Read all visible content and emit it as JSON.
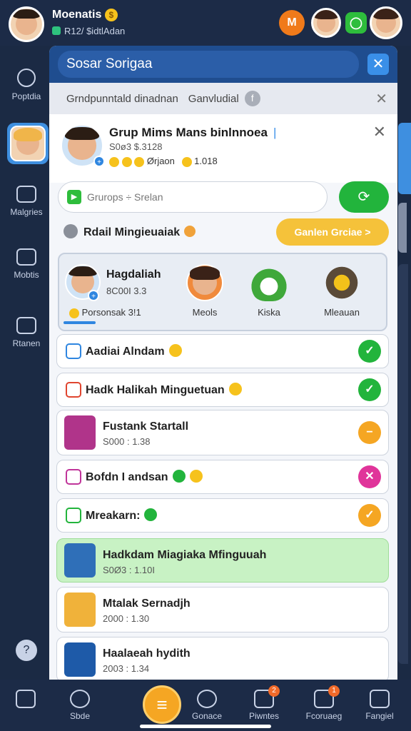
{
  "topbar": {
    "name": "Moenatis",
    "coin_glyph": "$",
    "subtitle": "R12/ $idtlAdan",
    "orange_button_label": "M"
  },
  "rail": {
    "items": [
      {
        "label": "Poptdia"
      },
      {
        "label": "Malgries"
      },
      {
        "label": "Mobtis"
      },
      {
        "label": "Rtanen"
      }
    ]
  },
  "panel": {
    "header_title": "Sosar Sorigaa",
    "subheader_left": "Grndpunntald dinadnan",
    "subheader_right": "Ganvludial",
    "subheader_info_glyph": "f",
    "close_glyph": "✕"
  },
  "group": {
    "title": "Grup Mims Mans binlnnoea",
    "code": "S0ø3 $.3128",
    "meta": "Ørjaon",
    "meta_num": "1.018"
  },
  "search": {
    "placeholder": "Grurops ÷ Srelan",
    "go_glyph": "⟳"
  },
  "recent": {
    "label": "Rdail Mingieuaiak",
    "action_label": "Ganlen Grciae >"
  },
  "feature": {
    "name": "Hagdaliah",
    "code": "8C00I 3.3",
    "tag": "Porsonsak 3!1",
    "progress_percent": 10,
    "thumbs": [
      {
        "label": "Meols"
      },
      {
        "label": "Kiska"
      },
      {
        "label": "Mleauan"
      }
    ]
  },
  "list": [
    {
      "label": "Aadiai Alndam",
      "action_color": "#22b43c",
      "action_glyph": "✓",
      "icon_color": "#2f86e0"
    },
    {
      "label": "Hadk Halikah Minguetuan",
      "action_color": "#22b43c",
      "action_glyph": "✓",
      "icon_color": "#e0452f"
    },
    {
      "title": "Fustank Startall",
      "sub": "S000 : 1.38",
      "action_color": "#f5a623",
      "action_glyph": "−"
    },
    {
      "label": "Bofdn I andsan",
      "action_color": "#e0349a",
      "action_glyph": "✕",
      "icon_color": "#c0349a"
    },
    {
      "label": "Mreakarn:",
      "action_color": "#f5a623",
      "action_glyph": "✓",
      "icon_color": "#22b43c"
    },
    {
      "title": "Hadkdam Miagiaka Mfinguuah",
      "sub": "S0Ø3 : 1.10I"
    },
    {
      "title": "Mtalak Sernadjh",
      "sub": "2000 : 1.30"
    },
    {
      "title": "Haalaeah hydith",
      "sub": "2003 : 1.34"
    }
  ],
  "bottom_nav": {
    "items": [
      {
        "label": ""
      },
      {
        "label": "Sbde"
      },
      {
        "label": "Gonace"
      },
      {
        "label": "Piwntes",
        "badge": "2"
      },
      {
        "label": "Fcoruaeg",
        "badge": "1"
      },
      {
        "label": "Fangiel"
      }
    ],
    "center_glyph": "≡"
  }
}
